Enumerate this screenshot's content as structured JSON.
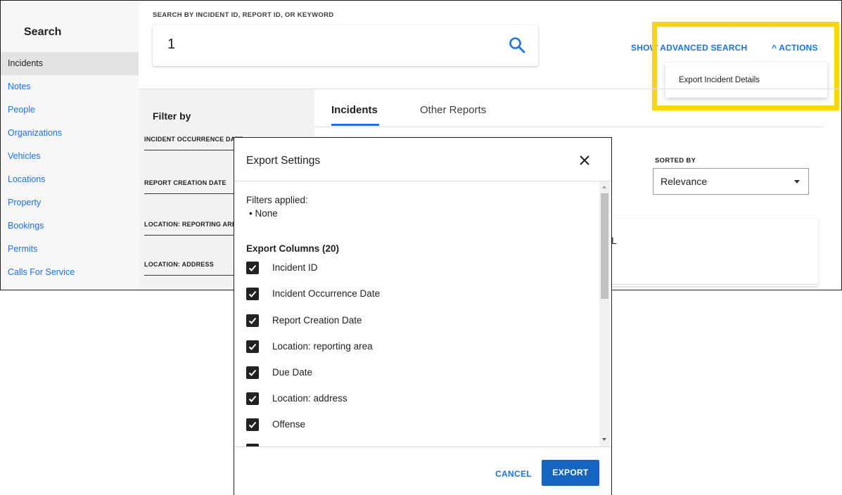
{
  "sidebar": {
    "title": "Search",
    "items": [
      {
        "label": "Incidents"
      },
      {
        "label": "Notes"
      },
      {
        "label": "People"
      },
      {
        "label": "Organizations"
      },
      {
        "label": "Vehicles"
      },
      {
        "label": "Locations"
      },
      {
        "label": "Property"
      },
      {
        "label": "Bookings"
      },
      {
        "label": "Permits"
      },
      {
        "label": "Calls For Service"
      }
    ]
  },
  "search": {
    "label": "SEARCH BY INCIDENT ID, REPORT ID, OR KEYWORD",
    "value": "1",
    "icon": "search-icon"
  },
  "header": {
    "advanced_link": "SHOW ADVANCED SEARCH",
    "actions_label": "^ ACTIONS",
    "actions_menu_item": "Export Incident Details"
  },
  "colors": {
    "accent": "#1a73e8",
    "highlight": "#fcd600",
    "primary_button": "#1565c0"
  },
  "filters": {
    "title": "Filter by",
    "items": [
      {
        "label": "INCIDENT OCCURRENCE DATE"
      },
      {
        "label": "REPORT CREATION DATE"
      },
      {
        "label": "LOCATION: REPORTING AREA"
      },
      {
        "label": "LOCATION: ADDRESS"
      }
    ]
  },
  "tabs": [
    {
      "label": "Incidents",
      "active": true
    },
    {
      "label": "Other Reports",
      "active": false
    }
  ],
  "sort": {
    "label": "SORTED BY",
    "value": "Relevance"
  },
  "result_card": {
    "text": "L"
  },
  "dialog": {
    "title": "Export Settings",
    "filters_label": "Filters applied:",
    "filters_value": "• None",
    "columns_label": "Export Columns (20)",
    "columns": [
      {
        "label": "Incident ID",
        "checked": true
      },
      {
        "label": "Incident Occurrence Date",
        "checked": true
      },
      {
        "label": "Report Creation Date",
        "checked": true
      },
      {
        "label": "Location: reporting area",
        "checked": true
      },
      {
        "label": "Due Date",
        "checked": true
      },
      {
        "label": "Location: address",
        "checked": true
      },
      {
        "label": "Offense",
        "checked": true
      },
      {
        "label": "",
        "checked": true
      }
    ],
    "cancel_label": "CANCEL",
    "export_label": "EXPORT"
  }
}
